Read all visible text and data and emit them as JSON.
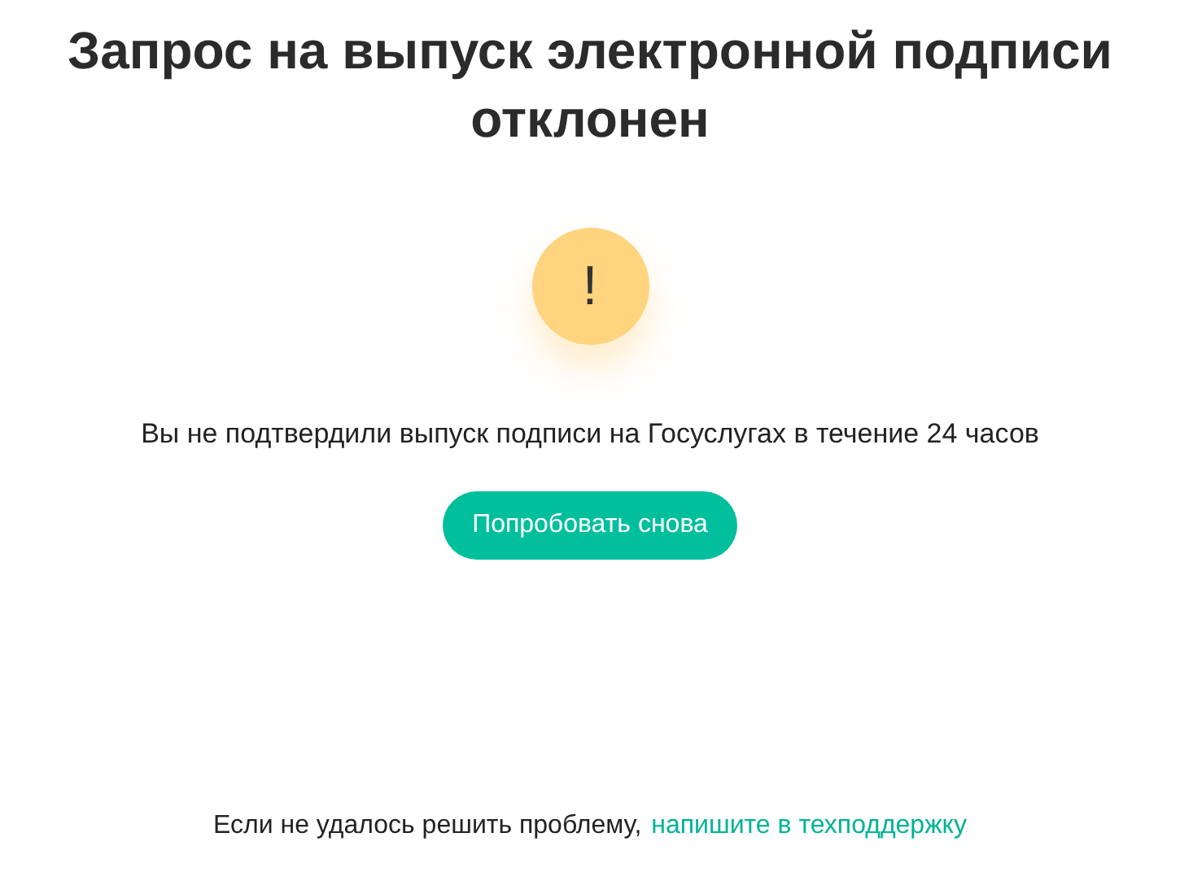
{
  "title": "Запрос на выпуск электронной подписи отклонен",
  "status_icon": {
    "symbol": "!"
  },
  "message": "Вы не подтвердили выпуск подписи на Госуслугах в течение 24 часов",
  "retry_button": "Попробовать снова",
  "footer": {
    "text": "Если не удалось решить проблему,",
    "link": "напишите в техподдержку"
  }
}
